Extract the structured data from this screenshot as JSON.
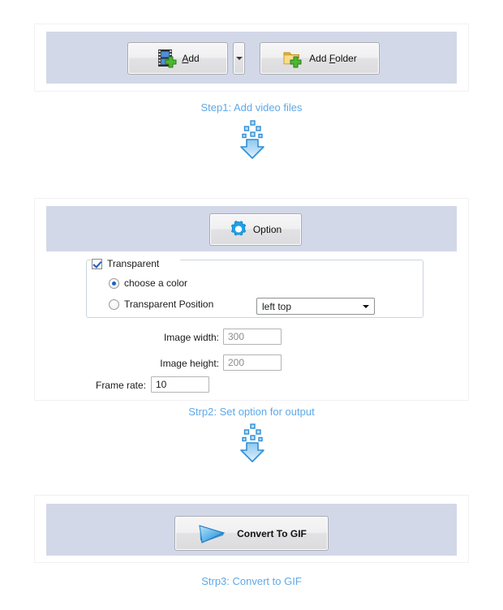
{
  "theme": {
    "panel_bg": "#d2d8e8",
    "page_bg": "#ffffff",
    "caption_color": "#5fa9e8",
    "arrow_color": "#2e8ed6",
    "frame_border": "#f1f1f3"
  },
  "step1": {
    "add_button": {
      "label_pre": "",
      "label_underline": "A",
      "label_post": "dd",
      "full_label": "Add",
      "icon": "film-add-icon"
    },
    "dropdown_toggle": {
      "icon": "chevron-down-icon"
    },
    "add_folder_button": {
      "label_pre": "Add ",
      "label_underline": "F",
      "label_post": "older",
      "full_label": "Add Folder",
      "icon": "folder-add-icon"
    },
    "caption": "Step1: Add video files",
    "arrow": "down-arrow-icon"
  },
  "step2": {
    "option_button": {
      "label": "Option",
      "icon": "gear-icon"
    },
    "transparent": {
      "checkbox_label": "Transparent",
      "checked": true,
      "radio_color": {
        "label": "choose a color",
        "selected": true
      },
      "radio_position": {
        "label": "Transparent Position",
        "selected": false
      },
      "position_combo": {
        "value": "left top",
        "icon": "chevron-down-icon"
      }
    },
    "fields": [
      {
        "label": "Image width:",
        "value": "300",
        "muted": true
      },
      {
        "label": "Image height:",
        "value": "200",
        "muted": true
      },
      {
        "label": "Frame rate:",
        "value": "10",
        "muted": false
      }
    ],
    "caption": "Strp2: Set option for output",
    "arrow": "down-arrow-icon"
  },
  "step3": {
    "convert_button": {
      "label": "Convert To GIF",
      "icon": "play-triangle-icon"
    },
    "caption": "Strp3: Convert to GIF"
  }
}
